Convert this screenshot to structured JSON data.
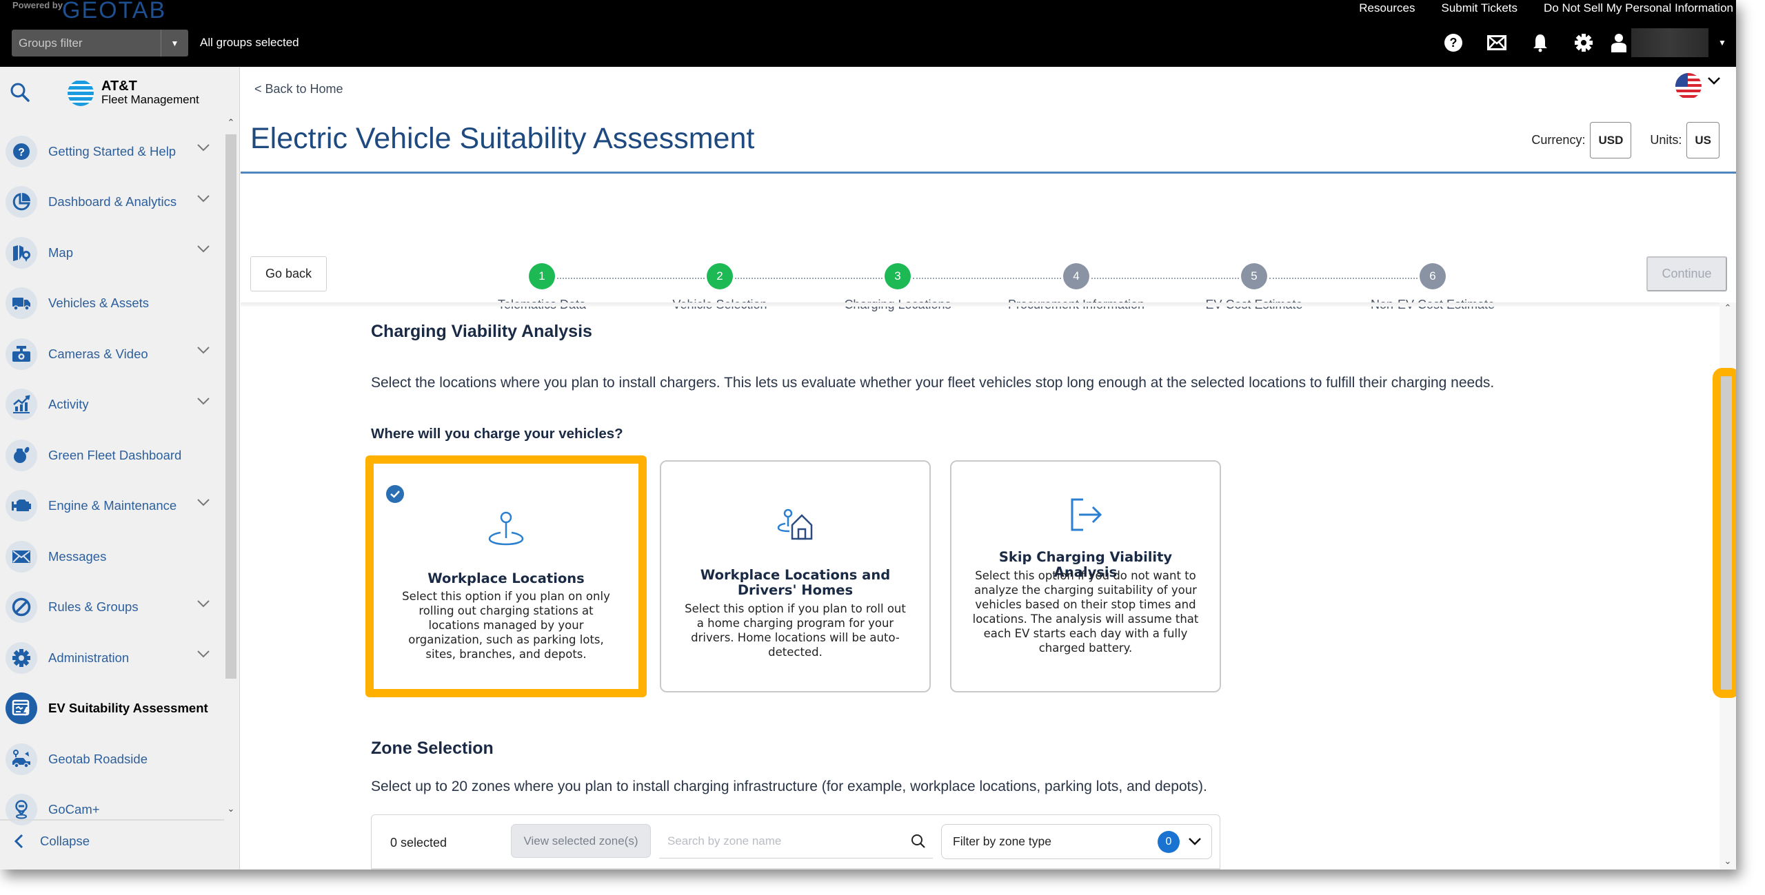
{
  "topbar": {
    "powered_by": "Powered by",
    "brand": "GEOTAB",
    "groups_filter_placeholder": "Groups filter",
    "groups_status": "All groups selected",
    "links": [
      "Resources",
      "Submit Tickets",
      "Do Not Sell My Personal Information"
    ],
    "icons": [
      "help-icon",
      "mail-icon",
      "bell-icon",
      "gear-icon",
      "user-icon"
    ]
  },
  "sidebar": {
    "logo_line1": "AT&T",
    "logo_line2": "Fleet Management",
    "items": [
      {
        "label": "Getting Started & Help",
        "icon": "help-icon",
        "expandable": true
      },
      {
        "label": "Dashboard & Analytics",
        "icon": "pie-chart-icon",
        "expandable": true
      },
      {
        "label": "Map",
        "icon": "map-icon",
        "expandable": true
      },
      {
        "label": "Vehicles & Assets",
        "icon": "truck-icon",
        "expandable": false
      },
      {
        "label": "Cameras & Video",
        "icon": "camera-icon",
        "expandable": true
      },
      {
        "label": "Activity",
        "icon": "activity-chart-icon",
        "expandable": true
      },
      {
        "label": "Green Fleet Dashboard",
        "icon": "green-fleet-icon",
        "expandable": false
      },
      {
        "label": "Engine & Maintenance",
        "icon": "engine-icon",
        "expandable": true
      },
      {
        "label": "Messages",
        "icon": "envelope-icon",
        "expandable": false
      },
      {
        "label": "Rules & Groups",
        "icon": "rules-icon",
        "expandable": true
      },
      {
        "label": "Administration",
        "icon": "gear-icon",
        "expandable": true
      },
      {
        "label": "EV Suitability Assessment",
        "icon": "ev-assessment-icon",
        "expandable": false,
        "active": true
      },
      {
        "label": "Geotab Roadside",
        "icon": "roadside-icon",
        "expandable": false
      },
      {
        "label": "GoCam+",
        "icon": "gocam-icon",
        "expandable": false
      }
    ],
    "collapse_label": "Collapse"
  },
  "header": {
    "back_link": "< Back to Home",
    "title": "Electric Vehicle Suitability Assessment",
    "currency_label": "Currency:",
    "currency_value": "USD",
    "units_label": "Units:",
    "units_value": "US",
    "language_flag": "us-flag-icon"
  },
  "stepper": {
    "current_step": 3,
    "steps": [
      {
        "num": "1",
        "label": "Telematics Data",
        "status": "complete"
      },
      {
        "num": "2",
        "label": "Vehicle Selection",
        "status": "complete"
      },
      {
        "num": "3",
        "label": "Charging Locations",
        "status": "current"
      },
      {
        "num": "4",
        "label": "Procurement Information",
        "status": "upcoming"
      },
      {
        "num": "5",
        "label": "EV Cost Estimate",
        "status": "upcoming"
      },
      {
        "num": "6",
        "label": "Non-EV Cost Estimate",
        "status": "upcoming"
      }
    ],
    "go_back_label": "Go back",
    "continue_label": "Continue",
    "continue_disabled": true
  },
  "charging": {
    "heading": "Charging Viability Analysis",
    "description": "Select the locations where you plan to install chargers. This lets us evaluate whether your fleet vehicles stop long enough at the selected locations to fulfill their charging needs.",
    "question": "Where will you charge your vehicles?",
    "options": [
      {
        "title": "Workplace Locations",
        "description": "Select this option if you plan on only rolling out charging stations at locations managed by your organization, such as parking lots, sites, branches, and depots.",
        "icon": "location-pin-icon",
        "selected": true
      },
      {
        "title": "Workplace Locations and Drivers' Homes",
        "description": "Select this option if you plan to roll out a home charging program for your drivers. Home locations will be auto-detected.",
        "icon": "pin-home-icon",
        "selected": false
      },
      {
        "title": "Skip Charging Viability Analysis",
        "description": "Select this option if you do not want to analyze the charging suitability of your vehicles based on their stop times and locations. The analysis will assume that each EV starts each day with a fully charged battery.",
        "icon": "exit-arrow-icon",
        "selected": false
      }
    ]
  },
  "zones": {
    "heading": "Zone Selection",
    "description": "Select up to 20 zones where you plan to install charging infrastructure (for example, workplace locations, parking lots, and depots).",
    "selected_count": "0 selected",
    "view_selected_label": "View selected zone(s)",
    "search_placeholder": "Search by zone name",
    "search_value": "",
    "filter_label": "Filter by zone type",
    "filter_count": "0"
  },
  "colors": {
    "step_complete": "#1db954",
    "step_upcoming": "#8a93a3",
    "highlight": "#ffb000",
    "primary": "#1f5fa8",
    "title": "#1f4a80"
  }
}
